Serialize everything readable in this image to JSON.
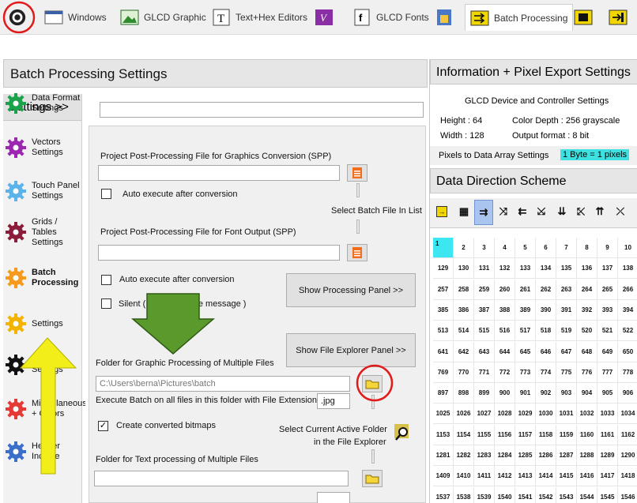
{
  "toolbar": {
    "items": [
      {
        "label": "",
        "icon": "gear-icon"
      },
      {
        "label": "Windows",
        "icon": "window-icon"
      },
      {
        "label": "GLCD Graphic",
        "icon": "image-icon"
      },
      {
        "label": "Text+Hex Editors",
        "icon": "text-icon"
      },
      {
        "label": "",
        "icon": "v-icon"
      },
      {
        "label": "GLCD Fonts",
        "icon": "font-icon"
      },
      {
        "label": "",
        "icon": "device-icon"
      },
      {
        "label": "Batch Processing",
        "icon": "batch-icon"
      },
      {
        "label": "",
        "icon": "film-icon"
      },
      {
        "label": "",
        "icon": "export-icon"
      }
    ]
  },
  "left": {
    "title": "Batch Processing Settings",
    "sidebar_head": "Settings >>",
    "sidebar_items": [
      {
        "label": "Data Format Settings",
        "color": "#1aa34a"
      },
      {
        "label": "Vectors Settings",
        "color": "#9b27b0"
      },
      {
        "label": "Touch Panel Settings",
        "color": "#5ab4ea"
      },
      {
        "label": "Grids / Tables Settings",
        "color": "#8c1d3a"
      },
      {
        "label": "Batch Processing",
        "color": "#f59a1b"
      },
      {
        "label": "Settings",
        "color": "#f2b400"
      },
      {
        "label": "System Settings",
        "color": "#111111"
      },
      {
        "label": "Miscellaneous + Colors",
        "color": "#e53935"
      },
      {
        "label": "Header Include",
        "color": "#3b6fc9"
      }
    ],
    "fields": {
      "spp_graphics_label": "Project Post-Processing File for Graphics Conversion (SPP)",
      "auto_exec_1": "Auto execute after conversion",
      "select_batch_file": "Select Batch File In List",
      "spp_font_label": "Project Post-Processing File for Font Output (SPP)",
      "auto_exec_2": "Auto execute after conversion",
      "silent": "Silent ( no occurrence message )",
      "show_processing_panel": "Show Processing Panel >>",
      "show_file_explorer_panel": "Show File Explorer Panel >>",
      "folder_graphic_label": "Folder for Graphic Processing of Multiple Files",
      "folder_graphic_value": "C:\\Users\\berna\\Pictures\\batch",
      "execute_batch_label": "Execute Batch on all files in this folder with File Extension",
      "extension_value": ".jpg",
      "create_converted": "Create converted bitmaps",
      "create_converted_check": "✓",
      "select_active_folder": "Select Current Active Folder",
      "in_file_explorer": "in the File Explorer",
      "folder_text_label": "Folder for Text processing of Multiple Files"
    }
  },
  "right": {
    "title": "Information + Pixel Export Settings",
    "device_header": "GLCD Device and Controller Settings",
    "height": "Height :  64",
    "width": "Width :  128",
    "color_depth": "Color Depth :  256 grayscale",
    "output_format": "Output format :  8 bit",
    "pixels_label": "Pixels to Data Array Settings",
    "pixels_badge": "1 Byte = 1 pixels",
    "direction_title": "Data Direction Scheme",
    "direction_icons": [
      "→",
      "⇉",
      "⤨",
      "⇇",
      "⤩",
      "⇊",
      "⤪",
      "⇈",
      "⤫"
    ]
  },
  "accent": {
    "red": "#e01b1b",
    "yellow": "#f2ee1a",
    "green": "#5a9a2c",
    "cyan": "#3de7f2"
  }
}
